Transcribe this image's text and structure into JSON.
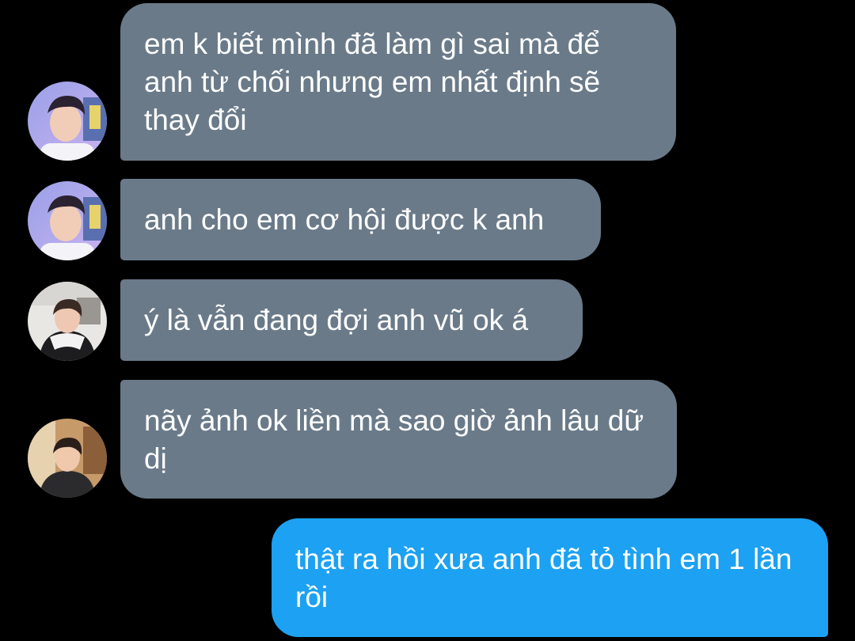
{
  "conversation": {
    "messages": [
      {
        "sender": "other",
        "text": "em k biết mình đã làm gì sai mà để anh từ chối nhưng em nhất định sẽ thay đổi",
        "avatar": "avatar-photo-boy-smiling"
      },
      {
        "sender": "other",
        "text": "anh cho em cơ hội được k anh",
        "avatar": "avatar-photo-boy-smiling"
      },
      {
        "sender": "other",
        "text": "ý là vẫn đang đợi anh vũ ok á",
        "avatar": "avatar-photo-boy-hoodie"
      },
      {
        "sender": "other",
        "text": "nãy ảnh ok liền mà sao giờ ảnh lâu dữ dị",
        "avatar": "avatar-photo-boy-cafe"
      },
      {
        "sender": "me",
        "text": "thật ra hồi xưa anh đã tỏ tình em 1 lần rồi"
      }
    ]
  },
  "colors": {
    "background": "#000000",
    "incoming_bubble": "#6a7a89",
    "outgoing_bubble": "#1da1f2",
    "text": "#ffffff"
  }
}
